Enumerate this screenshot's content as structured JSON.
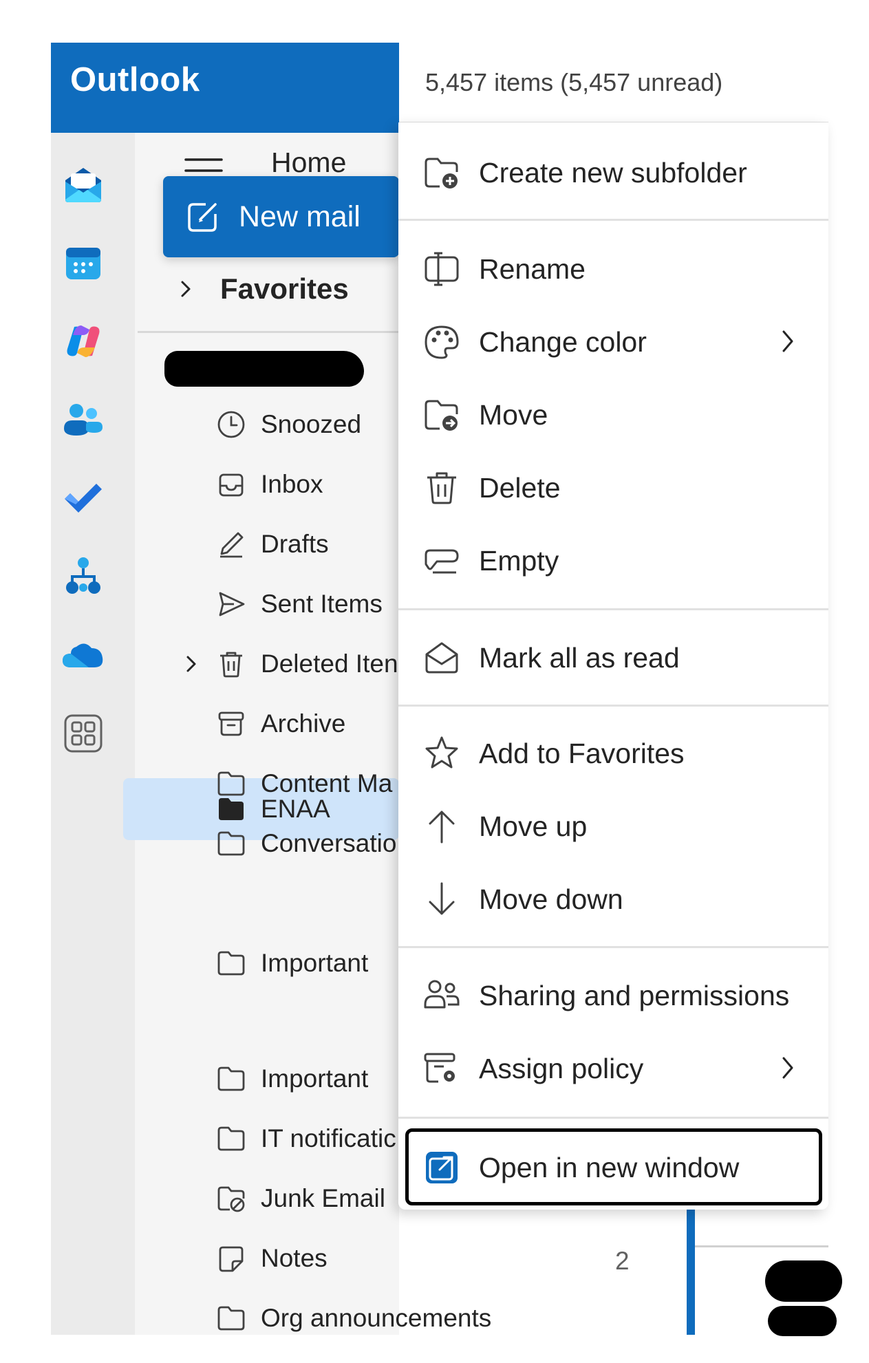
{
  "app": {
    "title": "Outlook"
  },
  "rail": {
    "items": [
      {
        "name": "mail-icon"
      },
      {
        "name": "calendar-icon"
      },
      {
        "name": "copilot-icon"
      },
      {
        "name": "people-icon"
      },
      {
        "name": "todo-icon"
      },
      {
        "name": "org-explorer-icon"
      },
      {
        "name": "onedrive-icon"
      },
      {
        "name": "more-apps-icon"
      }
    ]
  },
  "header": {
    "home_tab": "Home"
  },
  "new_mail": {
    "label": "New mail"
  },
  "nav": {
    "favorites": "Favorites"
  },
  "folders": [
    {
      "label": "Snoozed",
      "icon": "clock-icon"
    },
    {
      "label": "Inbox",
      "icon": "inbox-icon"
    },
    {
      "label": "Drafts",
      "icon": "pencil-icon"
    },
    {
      "label": "Sent Items",
      "icon": "send-icon"
    },
    {
      "label": "Deleted Iten",
      "icon": "trash-icon",
      "expandable": true
    },
    {
      "label": "Archive",
      "icon": "archive-icon"
    },
    {
      "label": "Content Ma",
      "icon": "folder-icon"
    },
    {
      "label": "Conversatio",
      "icon": "folder-icon"
    },
    {
      "label": "ENAA",
      "icon": "folder-filled-icon",
      "selected": true
    },
    {
      "label": "Important",
      "icon": "folder-icon"
    },
    {
      "label": "IT notificatic",
      "icon": "folder-icon"
    },
    {
      "label": "Junk Email",
      "icon": "junk-folder-icon"
    },
    {
      "label": "Notes",
      "icon": "note-icon",
      "count": "2"
    },
    {
      "label": "Org announcements",
      "icon": "folder-icon"
    }
  ],
  "list": {
    "count_label": "5,457 items (5,457 unread)"
  },
  "context_menu": {
    "items": [
      {
        "label": "Create new subfolder",
        "icon": "folder-add-icon"
      },
      {
        "label": "Rename",
        "icon": "rename-icon"
      },
      {
        "label": "Change color",
        "icon": "palette-icon",
        "submenu": true
      },
      {
        "label": "Move",
        "icon": "folder-move-icon"
      },
      {
        "label": "Delete",
        "icon": "trash-icon"
      },
      {
        "label": "Empty",
        "icon": "eraser-icon"
      },
      {
        "label": "Mark all as read",
        "icon": "envelope-open-icon"
      },
      {
        "label": "Add to Favorites",
        "icon": "star-icon"
      },
      {
        "label": "Move up",
        "icon": "arrow-up-icon"
      },
      {
        "label": "Move down",
        "icon": "arrow-down-icon"
      },
      {
        "label": "Sharing and permissions",
        "icon": "people-share-icon"
      },
      {
        "label": "Assign policy",
        "icon": "policy-icon",
        "submenu": true
      },
      {
        "label": "Open in new window",
        "icon": "open-window-icon",
        "focused": true
      }
    ]
  },
  "colors": {
    "brand": "#0f6cbd",
    "selected_bg": "#cfe4fa"
  }
}
